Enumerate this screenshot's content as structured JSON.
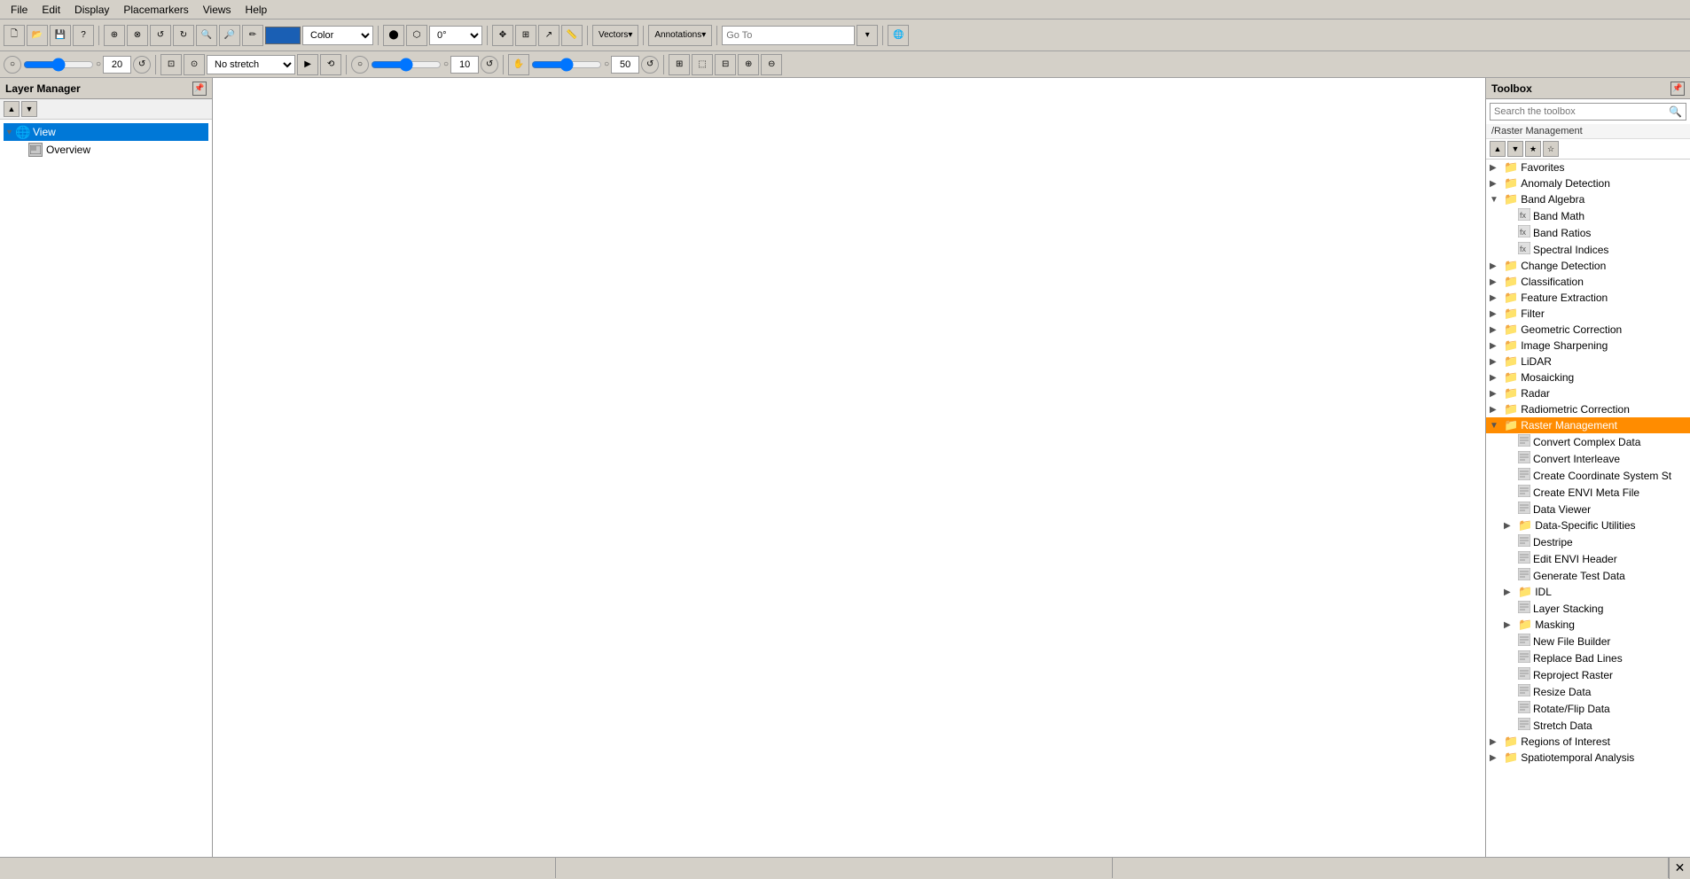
{
  "menubar": {
    "items": [
      "File",
      "Edit",
      "Display",
      "Placemarkers",
      "Views",
      "Help"
    ]
  },
  "toolbar1": {
    "color_value": "#1a5fb4",
    "vectors_label": "Vectors",
    "annotations_label": "Annotations",
    "go_to_placeholder": "Go To",
    "rotation_value": "0°"
  },
  "toolbar2": {
    "stretch_value": "No stretch",
    "value1": "20",
    "value2": "10",
    "value3": "50"
  },
  "layer_manager": {
    "title": "Layer Manager",
    "items": [
      {
        "label": "View",
        "level": 0,
        "type": "globe",
        "expanded": true
      },
      {
        "label": "Overview",
        "level": 1,
        "type": "overview"
      }
    ]
  },
  "toolbox": {
    "title": "Toolbox",
    "search_placeholder": "Search the toolbox",
    "path": "/Raster Management",
    "tree": [
      {
        "label": "Favorites",
        "level": 0,
        "type": "folder",
        "expandable": true,
        "expanded": false
      },
      {
        "label": "Anomaly Detection",
        "level": 0,
        "type": "folder",
        "expandable": true,
        "expanded": false
      },
      {
        "label": "Band Algebra",
        "level": 0,
        "type": "folder",
        "expandable": true,
        "expanded": true
      },
      {
        "label": "Band Math",
        "level": 1,
        "type": "formula",
        "expandable": false
      },
      {
        "label": "Band Ratios",
        "level": 1,
        "type": "formula",
        "expandable": false
      },
      {
        "label": "Spectral Indices",
        "level": 1,
        "type": "formula",
        "expandable": false
      },
      {
        "label": "Change Detection",
        "level": 0,
        "type": "folder",
        "expandable": true,
        "expanded": false
      },
      {
        "label": "Classification",
        "level": 0,
        "type": "folder",
        "expandable": true,
        "expanded": false
      },
      {
        "label": "Feature Extraction",
        "level": 0,
        "type": "folder",
        "expandable": true,
        "expanded": false
      },
      {
        "label": "Filter",
        "level": 0,
        "type": "folder",
        "expandable": true,
        "expanded": false
      },
      {
        "label": "Geometric Correction",
        "level": 0,
        "type": "folder",
        "expandable": true,
        "expanded": false
      },
      {
        "label": "Image Sharpening",
        "level": 0,
        "type": "folder",
        "expandable": true,
        "expanded": false
      },
      {
        "label": "LiDAR",
        "level": 0,
        "type": "folder",
        "expandable": true,
        "expanded": false
      },
      {
        "label": "Mosaicking",
        "level": 0,
        "type": "folder",
        "expandable": true,
        "expanded": false
      },
      {
        "label": "Radar",
        "level": 0,
        "type": "folder",
        "expandable": true,
        "expanded": false
      },
      {
        "label": "Radiometric Correction",
        "level": 0,
        "type": "folder",
        "expandable": true,
        "expanded": false
      },
      {
        "label": "Raster Management",
        "level": 0,
        "type": "folder",
        "expandable": true,
        "expanded": true,
        "highlighted": true
      },
      {
        "label": "Convert Complex Data",
        "level": 1,
        "type": "file",
        "expandable": false
      },
      {
        "label": "Convert Interleave",
        "level": 1,
        "type": "file",
        "expandable": false
      },
      {
        "label": "Create Coordinate System St",
        "level": 1,
        "type": "file",
        "expandable": false
      },
      {
        "label": "Create ENVI Meta File",
        "level": 1,
        "type": "file",
        "expandable": false
      },
      {
        "label": "Data Viewer",
        "level": 1,
        "type": "file",
        "expandable": false
      },
      {
        "label": "Data-Specific Utilities",
        "level": 1,
        "type": "folder",
        "expandable": true,
        "expanded": false
      },
      {
        "label": "Destripe",
        "level": 1,
        "type": "file",
        "expandable": false
      },
      {
        "label": "Edit ENVI Header",
        "level": 1,
        "type": "file",
        "expandable": false
      },
      {
        "label": "Generate Test Data",
        "level": 1,
        "type": "file",
        "expandable": false
      },
      {
        "label": "IDL",
        "level": 1,
        "type": "folder",
        "expandable": true,
        "expanded": false
      },
      {
        "label": "Layer Stacking",
        "level": 1,
        "type": "file",
        "expandable": false
      },
      {
        "label": "Masking",
        "level": 1,
        "type": "folder",
        "expandable": true,
        "expanded": false
      },
      {
        "label": "New File Builder",
        "level": 1,
        "type": "file",
        "expandable": false
      },
      {
        "label": "Replace Bad Lines",
        "level": 1,
        "type": "file",
        "expandable": false
      },
      {
        "label": "Reproject Raster",
        "level": 1,
        "type": "file",
        "expandable": false
      },
      {
        "label": "Resize Data",
        "level": 1,
        "type": "file",
        "expandable": false
      },
      {
        "label": "Rotate/Flip Data",
        "level": 1,
        "type": "file",
        "expandable": false
      },
      {
        "label": "Stretch Data",
        "level": 1,
        "type": "file",
        "expandable": false
      },
      {
        "label": "Regions of Interest",
        "level": 0,
        "type": "folder",
        "expandable": true,
        "expanded": false
      },
      {
        "label": "Spatiotemporal Analysis",
        "level": 0,
        "type": "folder",
        "expandable": true,
        "expanded": false
      }
    ]
  },
  "statusbar": {
    "sections": [
      "",
      "",
      ""
    ]
  },
  "icons": {
    "minimize": "▬",
    "close": "✕",
    "expand": "▶",
    "collapse": "▼",
    "search": "🔍",
    "star_empty": "☆",
    "star_filled": "★",
    "up": "▲",
    "down": "▼",
    "pin": "📌"
  }
}
